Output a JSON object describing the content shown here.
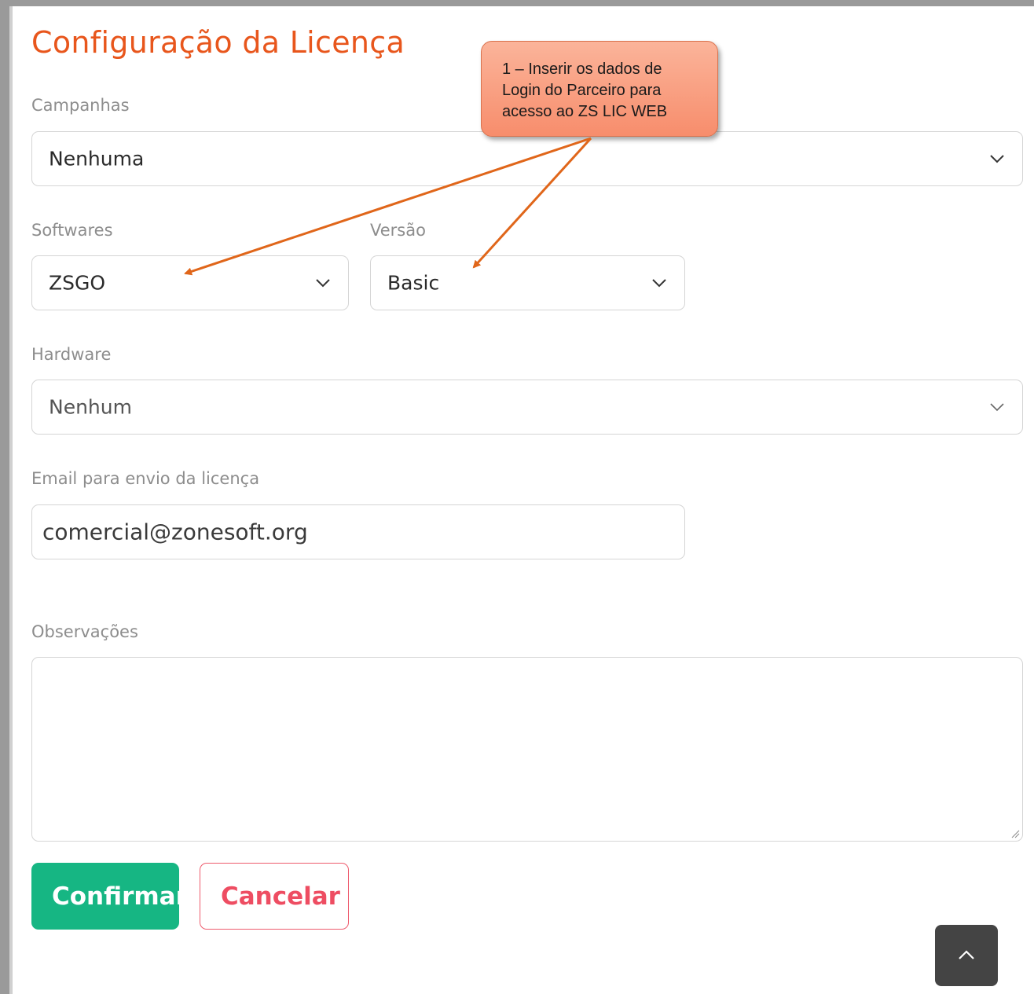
{
  "page": {
    "title": "Configuração da Licença"
  },
  "form": {
    "campanhas": {
      "label": "Campanhas",
      "value": "Nenhuma"
    },
    "softwares": {
      "label": "Softwares",
      "value": "ZSGO"
    },
    "versao": {
      "label": "Versão",
      "value": "Basic"
    },
    "hardware": {
      "label": "Hardware",
      "value": "Nenhum"
    },
    "email": {
      "label": "Email para envio da licença",
      "value": "comercial@zonesoft.org"
    },
    "observacoes": {
      "label": "Observações",
      "value": ""
    }
  },
  "buttons": {
    "confirm": "Confirmar",
    "cancel": "Cancelar"
  },
  "annotation": {
    "lines": [
      "1 – Inserir os dados de",
      "Login do Parceiro para",
      "acesso ao ZS LIC WEB"
    ]
  },
  "colors": {
    "title": "#e8561c",
    "confirm": "#16b683",
    "cancel": "#ee4d62",
    "callout": "#f78d6c",
    "arrow": "#e0661a"
  },
  "icons": {
    "select_chevron": "chevron-down-icon",
    "scroll_top": "chevron-up-icon"
  }
}
